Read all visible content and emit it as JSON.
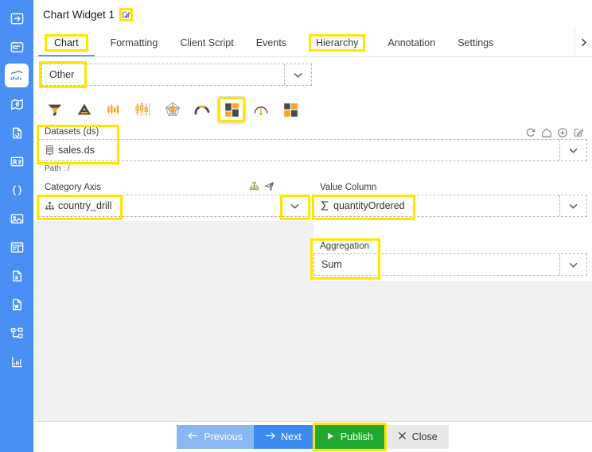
{
  "window": {
    "title": "Chart Widget 1",
    "edit_icon": "edit-pencil-icon"
  },
  "sidebar": {
    "items": [
      {
        "name": "expand-panel",
        "icon": "arrow-right-in-box-icon",
        "active": false
      },
      {
        "name": "form-layout",
        "icon": "form-panel-icon",
        "active": false
      },
      {
        "name": "chart-widget",
        "icon": "line-chart-icon",
        "active": true
      },
      {
        "name": "map-widget",
        "icon": "map-pin-icon",
        "active": false
      },
      {
        "name": "document-sync",
        "icon": "document-refresh-icon",
        "active": false
      },
      {
        "name": "id-card",
        "icon": "id-card-icon",
        "active": false
      },
      {
        "name": "code-block",
        "icon": "curly-braces-icon",
        "active": false
      },
      {
        "name": "image-widget",
        "icon": "image-picture-icon",
        "active": false
      },
      {
        "name": "window-panel",
        "icon": "window-layout-icon",
        "active": false
      },
      {
        "name": "excel-export",
        "icon": "excel-file-icon",
        "active": false
      },
      {
        "name": "word-export",
        "icon": "word-file-icon",
        "active": false
      },
      {
        "name": "tree-view",
        "icon": "tree-hierarchy-icon",
        "active": false
      },
      {
        "name": "bar-chart",
        "icon": "bar-chart-icon",
        "active": false
      }
    ]
  },
  "tabs": {
    "items": [
      {
        "label": "Chart",
        "active": true,
        "highlighted": true
      },
      {
        "label": "Formatting",
        "active": false,
        "highlighted": false
      },
      {
        "label": "Client Script",
        "active": false,
        "highlighted": false
      },
      {
        "label": "Events",
        "active": false,
        "highlighted": false
      },
      {
        "label": "Hierarchy",
        "active": false,
        "highlighted": true
      },
      {
        "label": "Annotation",
        "active": false,
        "highlighted": false
      },
      {
        "label": "Settings",
        "active": false,
        "highlighted": false
      }
    ],
    "scroll_right_icon": "chevron-right-icon"
  },
  "chart_family": {
    "label": "",
    "value": "Other",
    "placeholder": "Other",
    "caret_icon": "chevron-down-icon"
  },
  "chart_types": {
    "items": [
      {
        "name": "funnel-chart",
        "icon": "funnel-icon",
        "selected": false
      },
      {
        "name": "pyramid-chart",
        "icon": "pyramid-icon",
        "selected": false
      },
      {
        "name": "candlestick-chart",
        "icon": "candlestick-icon",
        "selected": false
      },
      {
        "name": "boxplot-chart",
        "icon": "boxplot-icon",
        "selected": false
      },
      {
        "name": "radar-chart",
        "icon": "radar-pentagon-icon",
        "selected": false
      },
      {
        "name": "arc-gauge-chart",
        "icon": "arc-gauge-icon",
        "selected": false
      },
      {
        "name": "treemap-chart",
        "icon": "treemap-icon",
        "selected": true
      },
      {
        "name": "needle-gauge-chart",
        "icon": "needle-gauge-icon",
        "selected": false
      },
      {
        "name": "tilemap-chart",
        "icon": "tilemap-icon",
        "selected": false
      }
    ]
  },
  "datasets": {
    "label": "Datasets (ds)",
    "value": "sales.ds",
    "value_icon": "database-stack-icon",
    "caret_icon": "chevron-down-icon",
    "path_text": "Path : /",
    "actions": [
      {
        "name": "refresh-dataset",
        "icon": "refresh-icon"
      },
      {
        "name": "home-dataset",
        "icon": "home-icon"
      },
      {
        "name": "add-dataset",
        "icon": "plus-circle-icon"
      },
      {
        "name": "edit-dataset",
        "icon": "edit-pencil-icon"
      }
    ]
  },
  "category_axis": {
    "label": "Category Axis",
    "value": "country_drill",
    "value_icon": "hierarchy-org-icon",
    "caret_icon": "chevron-down-icon",
    "actions": [
      {
        "name": "drill-hierarchy",
        "icon": "hierarchy-org-icon"
      },
      {
        "name": "navigate-send",
        "icon": "send-arrow-icon"
      }
    ]
  },
  "value_column": {
    "label": "Value Column",
    "value": "quantityOrdered",
    "value_icon": "sigma-sum-icon",
    "caret_icon": "chevron-down-icon"
  },
  "aggregation": {
    "label": "Aggregation",
    "value": "Sum",
    "caret_icon": "chevron-down-icon"
  },
  "footer": {
    "previous": {
      "label": "Previous",
      "icon": "arrow-left-icon"
    },
    "next": {
      "label": "Next",
      "icon": "arrow-right-icon"
    },
    "publish": {
      "label": "Publish",
      "icon": "play-triangle-icon"
    },
    "close": {
      "label": "Close",
      "icon": "close-x-icon"
    }
  },
  "colors": {
    "sidebar": "#4a90f4",
    "accent_blue": "#3d8bf0",
    "publish_green": "#22a830",
    "highlight_yellow": "#ffe600",
    "orange": "#f5a623",
    "dark_gray": "#4a4a4a",
    "body_gray": "#f1f1f1"
  }
}
